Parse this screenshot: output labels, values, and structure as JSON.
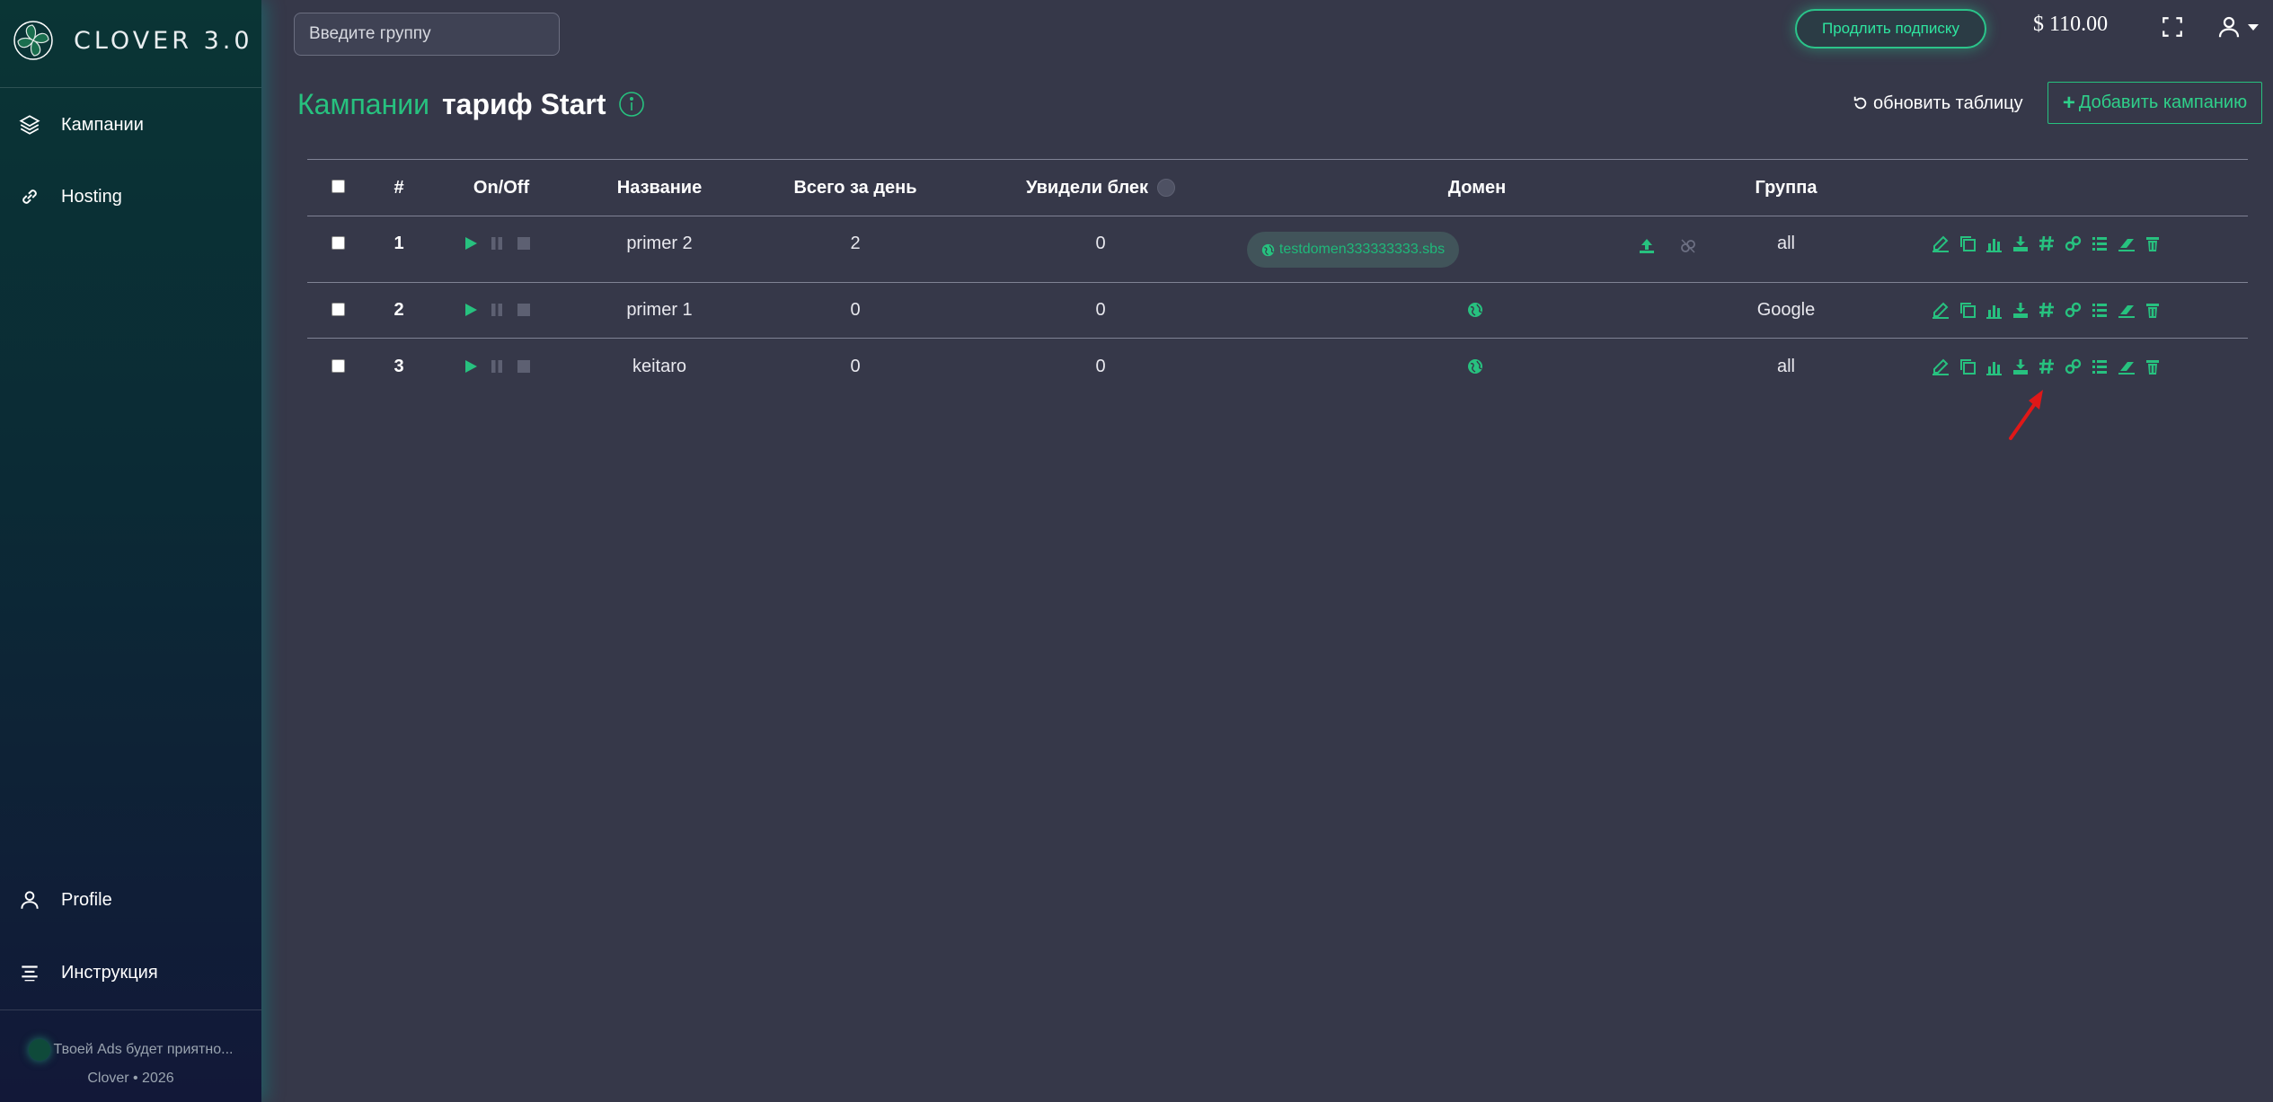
{
  "brand": {
    "name": "CLOVER 3.0"
  },
  "sidebar": {
    "items": [
      {
        "label": "Кампании",
        "icon": "layers-icon"
      },
      {
        "label": "Hosting",
        "icon": "link-icon"
      }
    ],
    "bottom_items": [
      {
        "label": "Profile",
        "icon": "user-icon"
      },
      {
        "label": "Инструкция",
        "icon": "list-icon"
      }
    ],
    "footer": {
      "tagline": "Твоей Ads будет приятно...",
      "copyright": "Clover • 2026"
    }
  },
  "topbar": {
    "search_placeholder": "Введите группу",
    "renew_label": "Продлить подписку",
    "balance": "$  110.00"
  },
  "header": {
    "title": "Кампании",
    "tariff": "тариф Start",
    "refresh_label": "обновить таблицу",
    "add_label": "Добавить кампанию"
  },
  "table": {
    "columns": [
      "#",
      "On/Off",
      "Название",
      "Всего за день",
      "Увидели блек",
      "Домен",
      "Группа"
    ],
    "rows": [
      {
        "num": "1",
        "name": "primer 2",
        "total": "2",
        "seen": "0",
        "domain": "testdomen333333333.sbs",
        "group": "all"
      },
      {
        "num": "2",
        "name": "primer 1",
        "total": "0",
        "seen": "0",
        "domain": "",
        "group": "Google"
      },
      {
        "num": "3",
        "name": "keitaro",
        "total": "0",
        "seen": "0",
        "domain": "",
        "group": "all"
      }
    ]
  },
  "colors": {
    "accent": "#27c17f",
    "background": "#363849",
    "sidebar": "#0b2a35",
    "highlight_arrow": "#e01818"
  }
}
